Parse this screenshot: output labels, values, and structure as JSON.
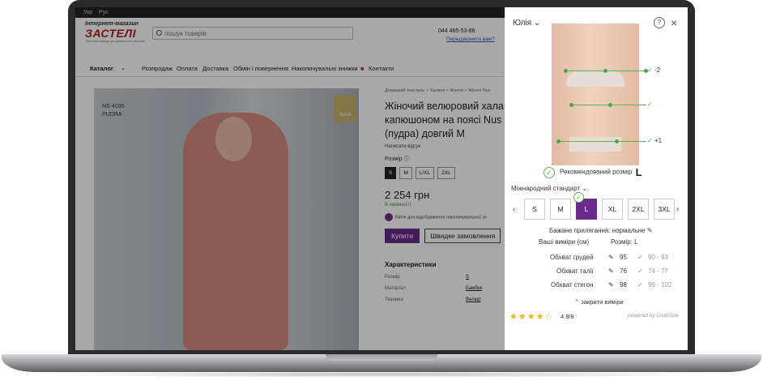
{
  "site": {
    "lang": [
      "Укр",
      "Рус"
    ],
    "logo_top": "Інтернет-магазин",
    "logo_main": "ЗАСТЕЛІ",
    "logo_sub": "Текстильні бренди для домашнього текстилю",
    "search_placeholder": "пошук товарів",
    "phone": "044 465-53-88",
    "callback": "Передзвонити вам?",
    "nav": [
      "Каталог",
      "Розпродаж",
      "Оплата",
      "Доставка",
      "Обмін і повернення",
      "Накопичувальні знижки",
      "Контакти"
    ],
    "product_code": "NS-4035",
    "product_color": "PUDRA",
    "brand_badge": "NusA",
    "breadcrumb": "Домашній текстиль  >  Халати  >  Жіночі  >  Жіночі Nus",
    "title_lines": [
      "Жіночий велюровий хала",
      "капюшоном на поясі Nus",
      "(пудра) довгий М"
    ],
    "review": "Написати відгук",
    "size_label": "Розмір",
    "sizes": [
      "S",
      "M",
      "L/XL",
      "2XL"
    ],
    "price": "2 254 грн",
    "availability": "В наявності",
    "promo": "Війти для відображення накопичувальної зн",
    "buy": "Купити",
    "quick": "Швидке замовлення",
    "char_title": "Характеристики",
    "chars": [
      {
        "k": "Розмір",
        "v": "S"
      },
      {
        "k": "Матеріал",
        "v": "Бамбук"
      },
      {
        "k": "Тканина",
        "v": "Велюр"
      }
    ]
  },
  "widget": {
    "name": "Юлія",
    "help": "?",
    "close": "×",
    "marks": [
      "-2",
      "",
      "+1"
    ],
    "recommended_label": "Рекомендований розмір",
    "recommended_size": "L",
    "standard": "Міжнародний стандарт",
    "sizes": [
      "S",
      "M",
      "L",
      "XL",
      "2XL",
      "3XL"
    ],
    "selected_size": "L",
    "fit": "Бажане прилягання: нормальне",
    "your_measurements": "Ваші виміри (см)",
    "size_col": "Розмір: L",
    "rows": [
      {
        "label": "Обхват грудей",
        "value": "95",
        "range": "90 - 93"
      },
      {
        "label": "Обхват талії",
        "value": "76",
        "range": "74 - 77"
      },
      {
        "label": "Обхват стегон",
        "value": "98",
        "range": "99 - 102"
      }
    ],
    "close_measurements": "закрити виміри",
    "stars": "★★★★☆",
    "rating": "4.9/8",
    "powered": "powered by LookSize"
  }
}
